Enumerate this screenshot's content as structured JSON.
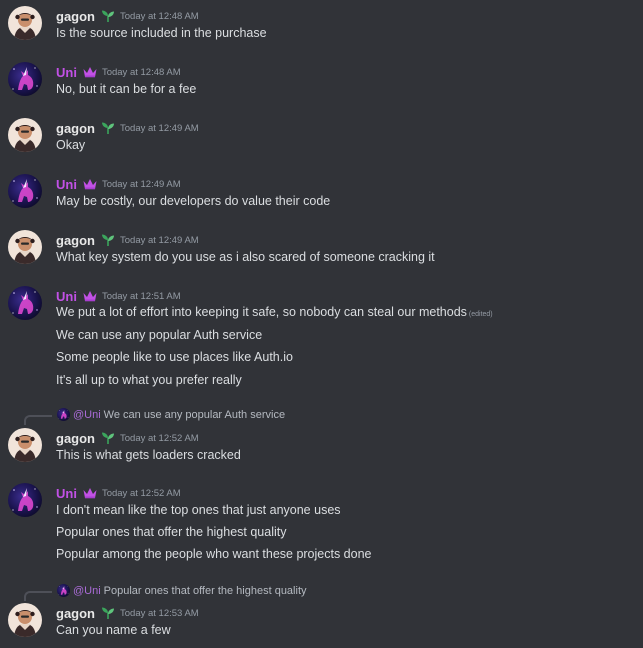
{
  "colors": {
    "background": "#313338",
    "gagon_name": "#e8e8e8",
    "uni_name": "#c251e6",
    "timestamp": "#949ba4",
    "text": "#dbdee1",
    "leaf_badge": "#3ba55c",
    "crown_badge": "#c251e6"
  },
  "messages": [
    {
      "author": "gagon",
      "badge": "leaf-badge-icon",
      "timestamp": "Today at 12:48 AM",
      "lines": [
        {
          "text": "Is the source included in the purchase"
        }
      ]
    },
    {
      "author": "Uni",
      "badge": "crown-badge-icon",
      "timestamp": "Today at 12:48 AM",
      "lines": [
        {
          "text": "No, but it can be for a fee"
        }
      ]
    },
    {
      "author": "gagon",
      "badge": "leaf-badge-icon",
      "timestamp": "Today at 12:49 AM",
      "lines": [
        {
          "text": "Okay"
        }
      ]
    },
    {
      "author": "Uni",
      "badge": "crown-badge-icon",
      "timestamp": "Today at 12:49 AM",
      "lines": [
        {
          "text": "May be costly, our developers do value their code"
        }
      ]
    },
    {
      "author": "gagon",
      "badge": "leaf-badge-icon",
      "timestamp": "Today at 12:49 AM",
      "lines": [
        {
          "text": "What key system do you use as i also scared of someone cracking it"
        }
      ]
    },
    {
      "author": "Uni",
      "badge": "crown-badge-icon",
      "timestamp": "Today at 12:51 AM",
      "lines": [
        {
          "text": "We put a lot of effort into keeping it safe, so nobody can steal our methods",
          "edited": "(edited)"
        },
        {
          "text": "We can use any popular Auth service"
        },
        {
          "text": "Some people like to use places like Auth.io"
        },
        {
          "text": "It's all up to what you prefer really"
        }
      ]
    },
    {
      "reply": {
        "mention": "@Uni",
        "text": "We can use any popular Auth service"
      },
      "author": "gagon",
      "badge": "leaf-badge-icon",
      "timestamp": "Today at 12:52 AM",
      "lines": [
        {
          "text": "This is what gets loaders cracked"
        }
      ]
    },
    {
      "author": "Uni",
      "badge": "crown-badge-icon",
      "timestamp": "Today at 12:52 AM",
      "lines": [
        {
          "text": "I don't mean like the top ones that just anyone uses"
        },
        {
          "text": "Popular ones that offer the highest quality"
        },
        {
          "text": "Popular among the people who want these projects done"
        }
      ]
    },
    {
      "reply": {
        "mention": "@Uni",
        "text": "Popular ones that offer the highest quality"
      },
      "author": "gagon",
      "badge": "leaf-badge-icon",
      "timestamp": "Today at 12:53 AM",
      "lines": [
        {
          "text": "Can you name a few"
        }
      ]
    }
  ]
}
